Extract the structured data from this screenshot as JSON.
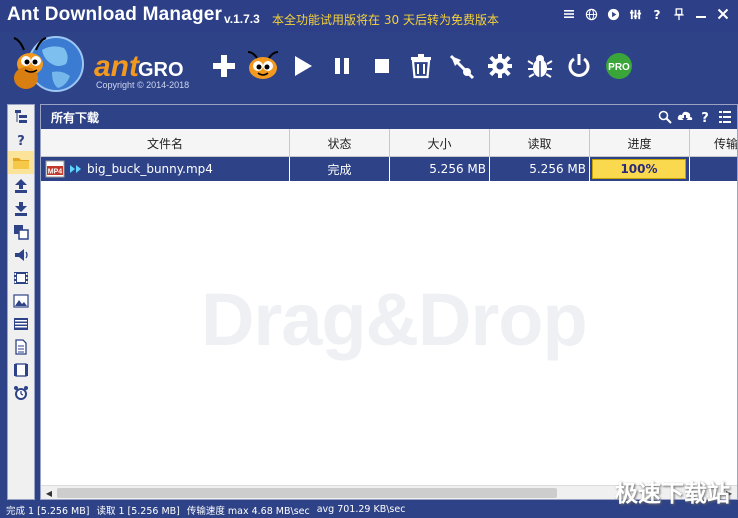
{
  "titlebar": {
    "app_name": "Ant Download Manager",
    "version": "v.1.7.3",
    "trial_prefix": "本全功能试用版将在",
    "trial_days": "30",
    "trial_suffix": "天后转为免费版本",
    "sys_icons": [
      "menu-icon",
      "globe-icon",
      "play-icon",
      "settings-icon",
      "help-icon",
      "pin-icon",
      "minimize-icon",
      "close-icon"
    ]
  },
  "brand": {
    "name_a": "ant",
    "name_b": "GROUP",
    "copyright": "Copyright © 2014-2018"
  },
  "toolbar": {
    "buttons": [
      "add-download-icon",
      "ant-mascot-icon",
      "start-icon",
      "pause-icon",
      "stop-icon",
      "delete-icon",
      "speed-icon",
      "settings-gear-icon",
      "bug-icon",
      "power-icon",
      "pro-icon"
    ],
    "pro_label": "PRO"
  },
  "sidebar": {
    "buttons": [
      "tree-icon",
      "help-icon",
      "folder-icon",
      "upload-icon",
      "download-icon",
      "copy-icon",
      "audio-icon",
      "video-icon",
      "image-icon",
      "archive-icon",
      "document-icon",
      "program-icon",
      "alarm-icon"
    ]
  },
  "panel": {
    "title": "所有下载",
    "tools": [
      "search-icon",
      "cloud-download-icon",
      "help-icon",
      "list-icon"
    ],
    "columns": [
      "文件名",
      "状态",
      "大小",
      "读取",
      "进度",
      "传输"
    ],
    "rows": [
      {
        "file_type": "MP4",
        "name": "big_buck_bunny.mp4",
        "status": "完成",
        "size": "5.256 MB",
        "read": "5.256 MB",
        "progress": "100%"
      }
    ],
    "empty_hint": "Drag&Drop"
  },
  "statusbar": {
    "done": "完成 1 [5.256 MB]",
    "read": "读取 1 [5.256 MB]",
    "speed": "传输速度 max 4.68 MB\\sec",
    "avg": "avg 701.29 KB\\sec"
  },
  "watermark": "极速下载站",
  "colors": {
    "primary": "#2e4288",
    "progress": "#fbd94f",
    "trial_text": "#f5d23a",
    "pro_badge": "#3aa63a"
  }
}
